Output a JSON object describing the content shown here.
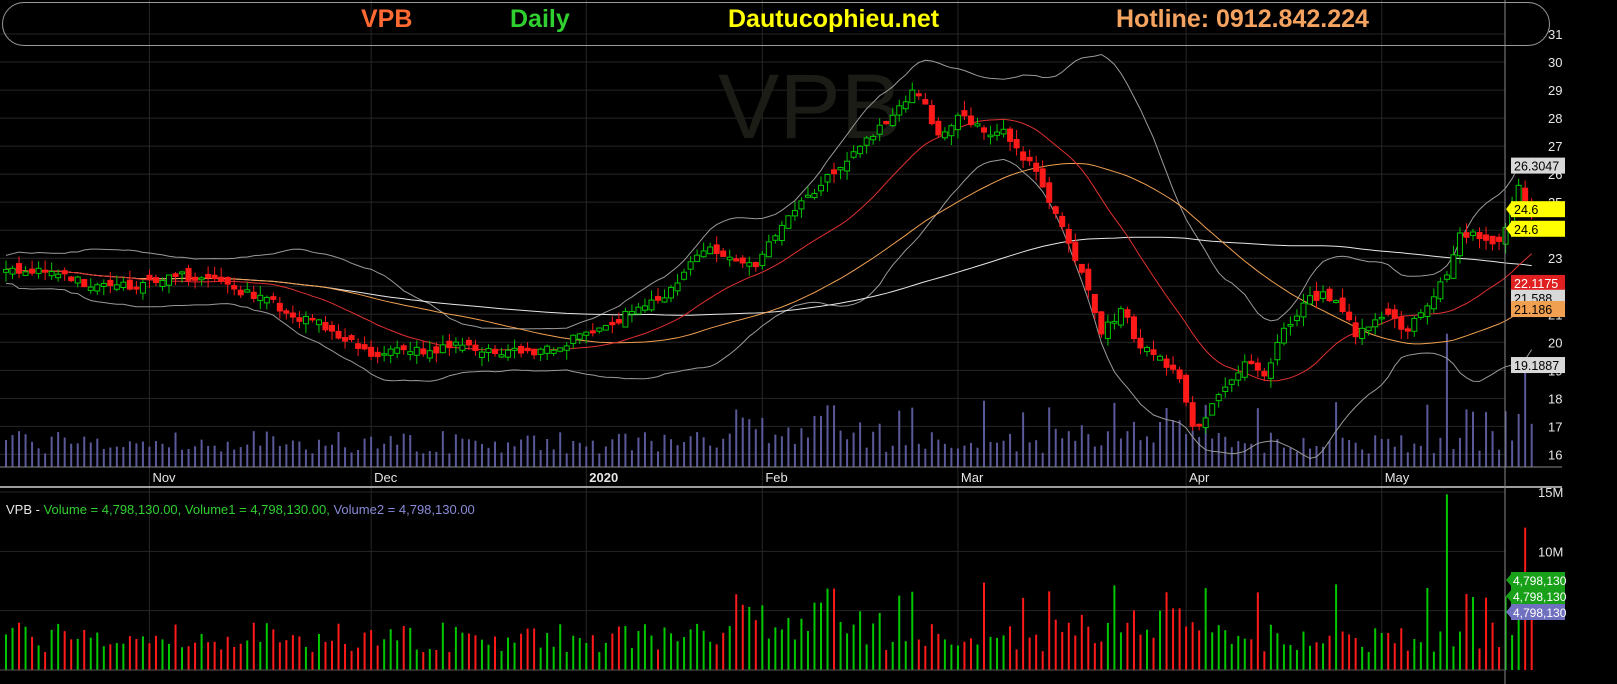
{
  "header": {
    "ticker": "VPB",
    "period": "Daily",
    "website": "Dautucophieu.net",
    "hotline": "Hotline: 0912.842.224"
  },
  "watermark": "VPB",
  "colors": {
    "background": "#000000",
    "grid": "#262626",
    "up_candle": "#00c800",
    "down_candle": "#ff1a1a",
    "ma_red": "#e03030",
    "ma_orange": "#f0a050",
    "ma_white": "#e8e8e8",
    "bollinger": "#9a9a9a",
    "volume_overlay": "#5a5a9a"
  },
  "volume_legend": {
    "prefix": "VPB - ",
    "volume": "Volume = 4,798,130.00,",
    "volume1": "Volume1 = 4,798,130.00,",
    "volume2": "Volume2 = 4,798,130.00"
  },
  "chart_data": {
    "type": "candlestick",
    "symbol": "VPB",
    "price_axis": {
      "ticks": [
        16,
        17,
        18,
        19,
        20,
        21,
        22,
        23,
        24,
        25,
        26,
        27,
        28,
        29,
        30,
        31
      ],
      "ylim": [
        15.55,
        31.5
      ]
    },
    "volume_axis": {
      "ticks": [
        "15M",
        "10M"
      ],
      "ylim": [
        0,
        15000000
      ]
    },
    "x_labels": [
      {
        "label": "Nov",
        "bar": 22
      },
      {
        "label": "Dec",
        "bar": 56
      },
      {
        "label": "2020",
        "bar": 89
      },
      {
        "label": "Feb",
        "bar": 116
      },
      {
        "label": "Mar",
        "bar": 146
      },
      {
        "label": "Apr",
        "bar": 181
      },
      {
        "label": "May",
        "bar": 211
      }
    ],
    "price_tags": [
      {
        "label": "26.3047",
        "value": 26.3047,
        "bg": "#d8d8d8",
        "fg": "#000000"
      },
      {
        "label": "24.6",
        "value": 24.75,
        "bg": "#ffff00",
        "fg": "#000000"
      },
      {
        "label": "24.6",
        "value": 24.05,
        "bg": "#ffff00",
        "fg": "#000000"
      },
      {
        "label": "22.1175",
        "value": 22.1175,
        "bg": "#e02020",
        "fg": "#ffffff"
      },
      {
        "label": "21.588",
        "value": 21.588,
        "bg": "#d8d8d8",
        "fg": "#000000"
      },
      {
        "label": "21.186",
        "value": 21.186,
        "bg": "#f0a050",
        "fg": "#000000"
      },
      {
        "label": "19.1887",
        "value": 19.1887,
        "bg": "#d8d8d8",
        "fg": "#000000"
      }
    ],
    "volume_tags": [
      {
        "label": "4,798,130",
        "bg": "#18a018",
        "fg": "#ffffff"
      },
      {
        "label": "4,798,130",
        "bg": "#18a018",
        "fg": "#ffffff"
      },
      {
        "label": "4,798,130",
        "bg": "#7070c0",
        "fg": "#ffffff"
      }
    ],
    "last_close": 24.6,
    "last_volume": 4798130,
    "anchors": [
      [
        0,
        22.6
      ],
      [
        6,
        22.5
      ],
      [
        10,
        22.2
      ],
      [
        15,
        22.1
      ],
      [
        20,
        21.9
      ],
      [
        25,
        22.4
      ],
      [
        30,
        22.3
      ],
      [
        35,
        21.9
      ],
      [
        40,
        21.6
      ],
      [
        44,
        20.9
      ],
      [
        48,
        20.8
      ],
      [
        50,
        20.4
      ],
      [
        53,
        20.1
      ],
      [
        56,
        19.5
      ],
      [
        60,
        19.8
      ],
      [
        65,
        19.7
      ],
      [
        70,
        19.9
      ],
      [
        75,
        19.6
      ],
      [
        80,
        19.7
      ],
      [
        85,
        19.8
      ],
      [
        88,
        20.3
      ],
      [
        92,
        20.6
      ],
      [
        96,
        21.1
      ],
      [
        100,
        21.5
      ],
      [
        104,
        22.5
      ],
      [
        108,
        23.4
      ],
      [
        112,
        22.9
      ],
      [
        115,
        22.7
      ],
      [
        118,
        23.8
      ],
      [
        121,
        24.7
      ],
      [
        125,
        25.6
      ],
      [
        130,
        26.8
      ],
      [
        135,
        27.8
      ],
      [
        139,
        29.0
      ],
      [
        141,
        28.5
      ],
      [
        143,
        27.4
      ],
      [
        146,
        28.1
      ],
      [
        150,
        27.5
      ],
      [
        153,
        27.6
      ],
      [
        156,
        26.5
      ],
      [
        158,
        26.1
      ],
      [
        161,
        24.6
      ],
      [
        165,
        22.5
      ],
      [
        168,
        20.3
      ],
      [
        171,
        21.2
      ],
      [
        174,
        19.8
      ],
      [
        177,
        19.5
      ],
      [
        180,
        18.7
      ],
      [
        182,
        17.0
      ],
      [
        184,
        17.3
      ],
      [
        187,
        18.4
      ],
      [
        190,
        19.3
      ],
      [
        193,
        18.8
      ],
      [
        196,
        20.5
      ],
      [
        199,
        21.4
      ],
      [
        202,
        21.8
      ],
      [
        205,
        21.1
      ],
      [
        207,
        20.2
      ],
      [
        210,
        20.8
      ],
      [
        212,
        21.0
      ],
      [
        215,
        20.4
      ],
      [
        218,
        21.3
      ],
      [
        221,
        22.4
      ],
      [
        223,
        23.9
      ],
      [
        226,
        23.7
      ],
      [
        229,
        23.6
      ],
      [
        231,
        24.9
      ],
      [
        232,
        25.6
      ],
      [
        234,
        24.6
      ]
    ],
    "series": [
      {
        "name": "MA",
        "type": "line"
      },
      {
        "name": "MA",
        "type": "line"
      },
      {
        "name": "MA",
        "type": "line"
      },
      {
        "name": "Bollinger",
        "type": "band"
      }
    ]
  }
}
